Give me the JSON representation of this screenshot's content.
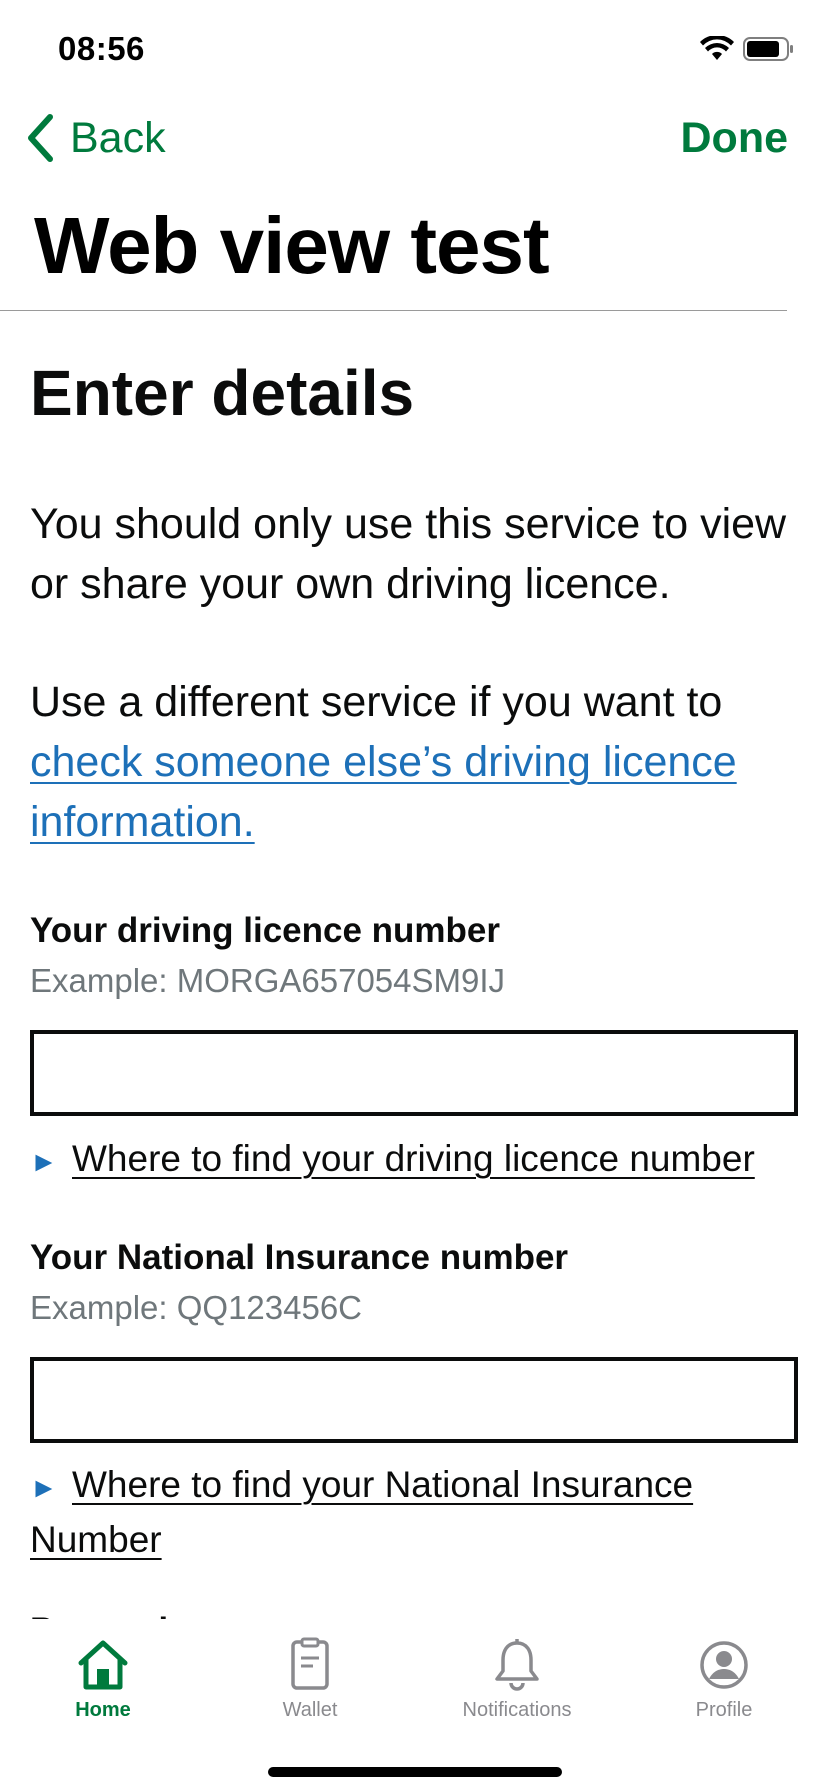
{
  "status_bar": {
    "time": "08:56"
  },
  "nav": {
    "back_label": "Back",
    "done_label": "Done",
    "title": "Web view test"
  },
  "content": {
    "heading": "Enter details",
    "para1": "You should only use this service to view or share your own driving licence.",
    "para2_text": "Use a different service if you want to ",
    "para2_link": "check someone else’s driving licence information.",
    "licence": {
      "label": "Your driving licence number",
      "hint": "Example: MORGA657054SM9IJ",
      "value": "",
      "details_arrow": "►",
      "details_summary": "Where to find your driving licence number"
    },
    "ni": {
      "label": "Your National Insurance number",
      "hint": "Example: QQ123456C",
      "value": "",
      "details_arrow": "►",
      "details_summary": "Where to find your National Insurance Number"
    },
    "next_label_partial": "Postcode"
  },
  "tabs": [
    {
      "label": "Home",
      "icon": "home-icon",
      "active": true
    },
    {
      "label": "Wallet",
      "icon": "wallet-icon",
      "active": false
    },
    {
      "label": "Notifications",
      "icon": "bell-icon",
      "active": false
    },
    {
      "label": "Profile",
      "icon": "profile-icon",
      "active": false
    }
  ],
  "colors": {
    "accent": "#007a3d",
    "link": "#1d70b8",
    "text": "#0b0c0c",
    "hint": "#6f777b",
    "inactive_tab": "#8a8a8e"
  }
}
